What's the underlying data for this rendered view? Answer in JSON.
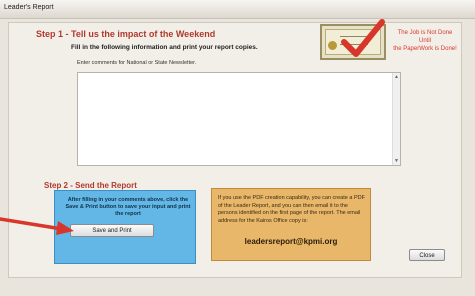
{
  "window": {
    "title": "Leader's Report"
  },
  "step1": {
    "heading": "Step 1 - Tell us the impact of the Weekend",
    "subheading": "Fill in the following information and print your report copies.",
    "comments_label": "Enter comments for National or State Newsletter.",
    "comments_value": ""
  },
  "certificate": {
    "slogan_line1": "The Job is Not Done",
    "slogan_line2": "Until",
    "slogan_line3": "the PaperWork is Done!"
  },
  "step2": {
    "heading": "Step 2 - Send the Report",
    "instructions": "After filling in your comments above, click the Save & Print button to save your input and print the report",
    "save_print_label": "Save and Print",
    "pdf_info": "If you use the PDF creation capability, you can create a PDF of the Leader Report, and you can then email it to the persons identified on the first page of the report.  The email address for the Kairos Office copy is:",
    "email": "leadersreport@kpmi.org"
  },
  "footer": {
    "close_label": "Close"
  },
  "colors": {
    "heading_red": "#b03a2e",
    "slogan_red": "#d93a2b",
    "blue_panel": "#63b7e6",
    "orange_panel": "#e8b76a",
    "arrow_red": "#d8362a"
  }
}
